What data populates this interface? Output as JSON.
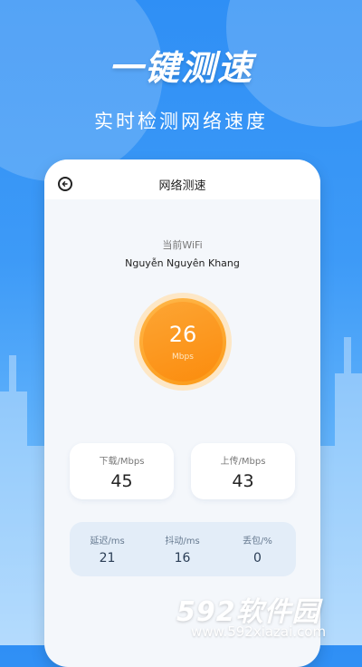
{
  "promo": {
    "headline": "一键测速",
    "subline": "实时检测网络速度"
  },
  "colors": {
    "background": "#3d9af7",
    "accent_orange": "#fb8c0d",
    "card_bg": "#ffffff"
  },
  "appbar": {
    "title": "网络测速",
    "back_icon": "back-arrow-circle-icon"
  },
  "wifi": {
    "label": "当前WiFi",
    "name": "Nguyễn Nguyên Khang"
  },
  "gauge": {
    "value": "26",
    "unit": "Mbps"
  },
  "download": {
    "label": "下载/Mbps",
    "value": "45"
  },
  "upload": {
    "label": "上传/Mbps",
    "value": "43"
  },
  "metrics": [
    {
      "label": "延迟/ms",
      "value": "21"
    },
    {
      "label": "抖动/ms",
      "value": "16"
    },
    {
      "label": "丢包/%",
      "value": "0"
    }
  ],
  "watermark": {
    "logo": "592软件园",
    "url": "www.592xiazai.com"
  }
}
